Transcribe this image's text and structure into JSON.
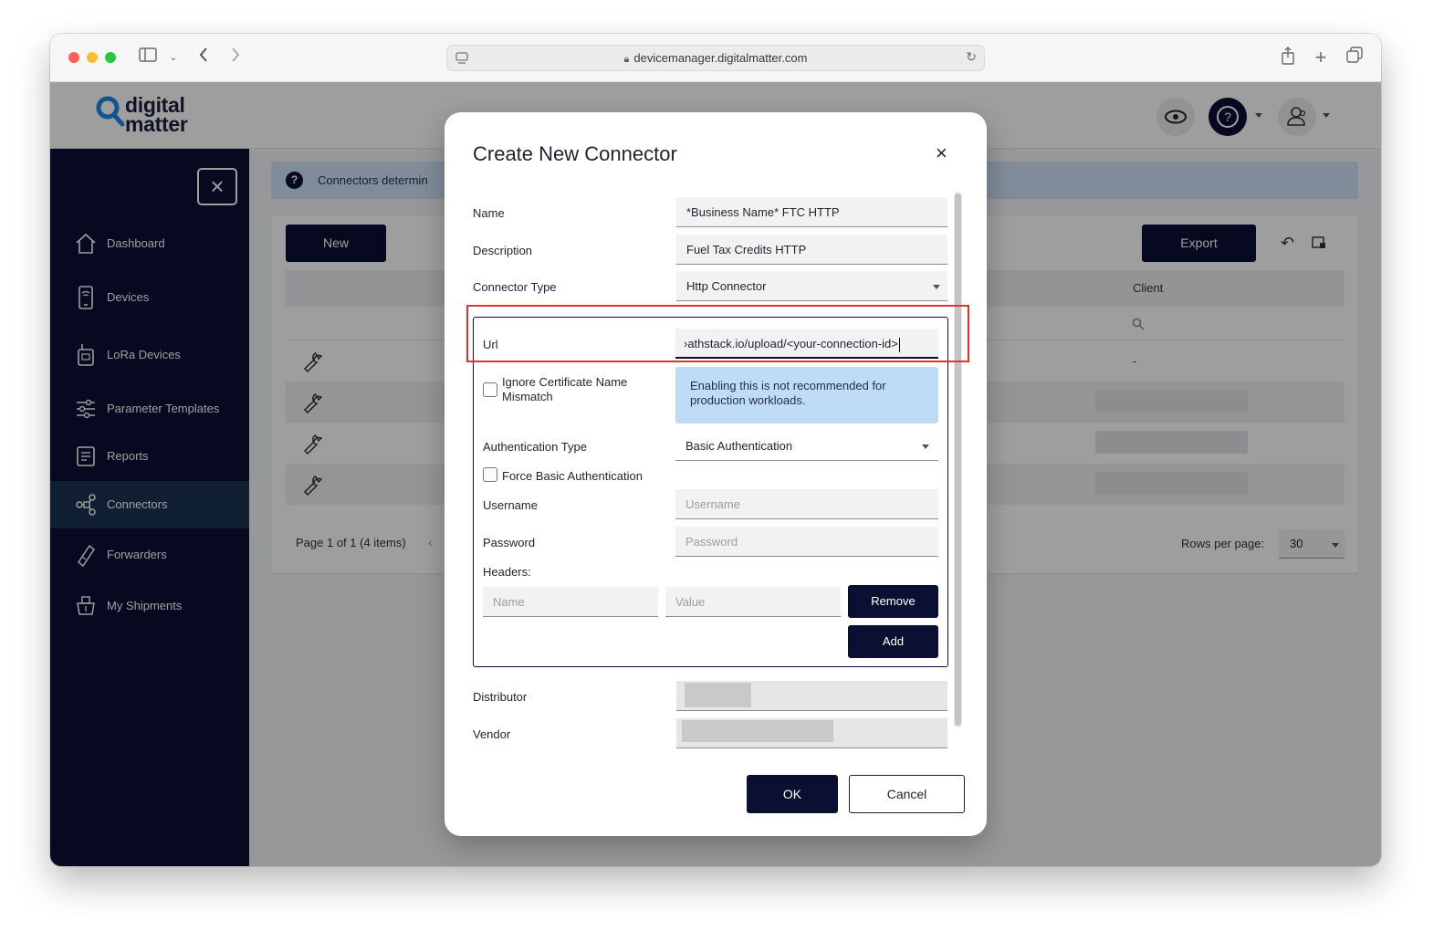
{
  "browser": {
    "url": "devicemanager.digitalmatter.com"
  },
  "brand": {
    "logo_text_line1": "digital",
    "logo_text_line2": "matter",
    "colors": {
      "navy": "#0b1033",
      "active_nav": "#1b3552",
      "info_blue": "#bfdcf6",
      "highlight_red": "#e5322d"
    }
  },
  "sidebar": {
    "items": [
      {
        "label": "Dashboard",
        "icon": "home-icon"
      },
      {
        "label": "Devices",
        "icon": "device-icon"
      },
      {
        "label": "LoRa Devices",
        "icon": "lora-device-icon"
      },
      {
        "label": "Parameter Templates",
        "icon": "sliders-icon"
      },
      {
        "label": "Reports",
        "icon": "report-icon"
      },
      {
        "label": "Connectors",
        "icon": "connectors-icon",
        "active": true
      },
      {
        "label": "Forwarders",
        "icon": "forwarder-icon"
      },
      {
        "label": "My Shipments",
        "icon": "shipment-icon"
      }
    ]
  },
  "page": {
    "banner_text": "Connectors determin",
    "new_label": "New",
    "export_label": "Export",
    "client_header": "Client",
    "dash_value": "-",
    "pager_text": "Page 1 of 1 (4 items)",
    "rows_per_page_label": "Rows per page:",
    "rows_per_page_value": "30"
  },
  "modal": {
    "title": "Create New Connector",
    "close": "×",
    "name_label": "Name",
    "name_value": "*Business Name* FTC HTTP",
    "description_label": "Description",
    "description_value": "Fuel Tax Credits HTTP",
    "connector_type_label": "Connector Type",
    "connector_type_value": "Http Connector",
    "url_label": "Url",
    "url_value": "›athstack.io/upload/<your-connection-id>",
    "ignore_cert_label": "Ignore Certificate Name Mismatch",
    "ignore_cert_info": "Enabling this is not recommended for production workloads.",
    "auth_type_label": "Authentication Type",
    "auth_type_value": "Basic Authentication",
    "force_basic_label": "Force Basic Authentication",
    "username_label": "Username",
    "username_placeholder": "Username",
    "password_label": "Password",
    "password_placeholder": "Password",
    "headers_label": "Headers:",
    "header_name_placeholder": "Name",
    "header_value_placeholder": "Value",
    "remove_label": "Remove",
    "add_label": "Add",
    "distributor_label": "Distributor",
    "vendor_label": "Vendor",
    "ok_label": "OK",
    "cancel_label": "Cancel"
  }
}
